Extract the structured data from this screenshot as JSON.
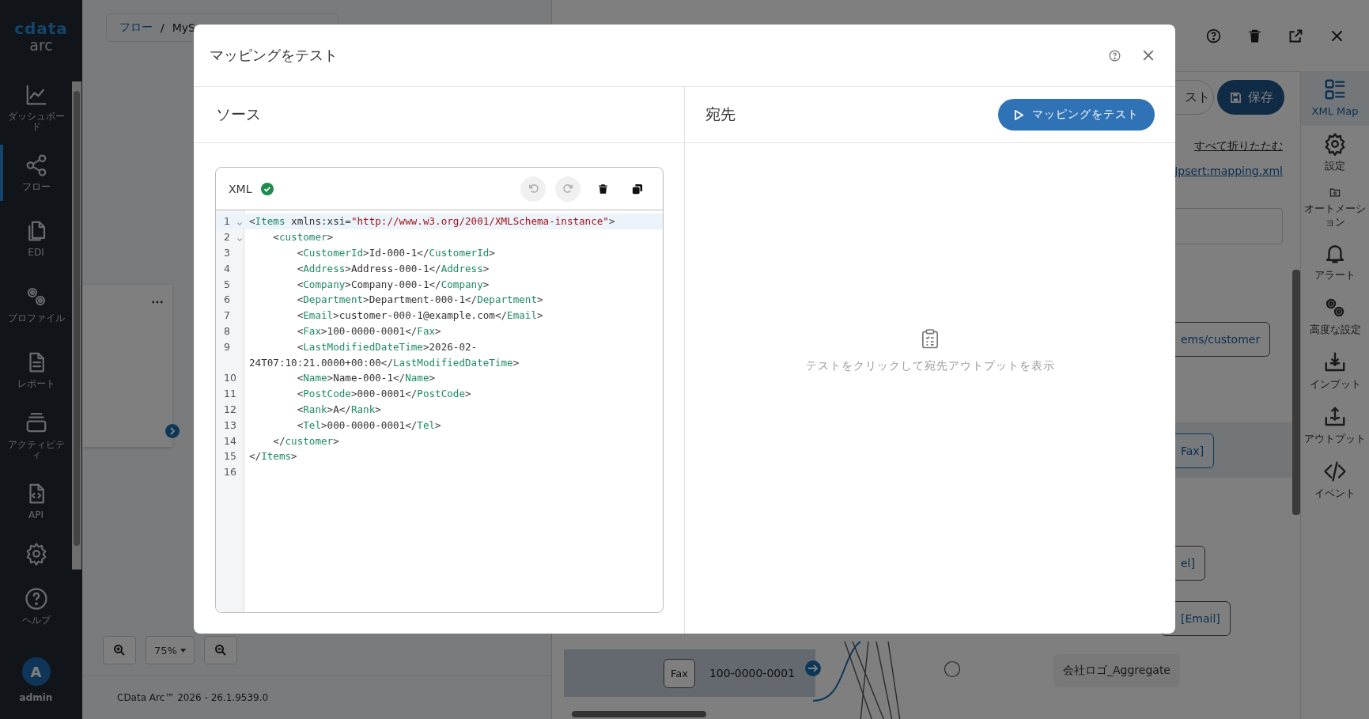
{
  "nav": {
    "logo_top": "cdata",
    "logo_bottom": "arc",
    "items": [
      {
        "label": "ダッシュボード",
        "selected": false
      },
      {
        "label": "フロー",
        "selected": true
      },
      {
        "label": "EDI",
        "selected": false
      },
      {
        "label": "プロファイル",
        "selected": false
      },
      {
        "label": "レポート",
        "selected": false
      },
      {
        "label": "アクティビティ",
        "selected": false
      },
      {
        "label": "API",
        "selected": false
      },
      {
        "selected": false
      },
      {
        "label": "ヘルプ",
        "selected": false
      }
    ],
    "user": {
      "initial": "A",
      "name": "admin"
    }
  },
  "flow_canvas": {
    "breadcrumb": [
      "フロー",
      "/",
      "MyS"
    ],
    "zoom": "75%",
    "footer": "CData Arc™ 2026 - 26.1.9539.0"
  },
  "mapping_panel": {
    "toolbar_buttons": [
      {
        "label": "スト",
        "kind": "outline"
      },
      {
        "label": "保存",
        "kind": "primary"
      }
    ],
    "links": [
      "すべて折りたたむ",
      "Jpsert:mapping.xml"
    ],
    "target_nodes": [
      {
        "label": "ems/customer",
        "highlighted": false
      },
      {
        "label": "Fax]",
        "highlighted": true
      },
      {
        "label": "el]",
        "highlighted": false
      },
      {
        "label": "[Email]",
        "highlighted": false
      }
    ],
    "source_row": {
      "label": "Fax",
      "value": "100-0000-0001"
    },
    "aggregate": "会社ロゴ_Aggregate"
  },
  "right_sidebar": [
    {
      "label": "XML Map",
      "selected": true
    },
    {
      "label": "設定",
      "selected": false
    },
    {
      "label": "オートメーション",
      "selected": false
    },
    {
      "label": "アラート",
      "selected": false
    },
    {
      "label": "高度な設定",
      "selected": false
    },
    {
      "label": "インプット",
      "selected": false
    },
    {
      "label": "アウトプット",
      "selected": false
    },
    {
      "label": "イベント",
      "selected": false
    }
  ],
  "modal": {
    "title": "マッピングをテスト",
    "source": {
      "heading": "ソース",
      "editor": {
        "format": "XML",
        "valid": true,
        "lines": [
          {
            "number": "1",
            "fold": true,
            "active": true,
            "tokens": [
              {
                "kind": "punct",
                "text": "<"
              },
              {
                "kind": "tag",
                "text": "Items"
              },
              {
                "kind": "attr",
                "text": " xmlns:xsi="
              },
              {
                "kind": "string",
                "text": "\"http://www.w3.org/2001/XMLSchema-instance\""
              },
              {
                "kind": "punct",
                "text": ">"
              }
            ]
          },
          {
            "number": "2",
            "fold": true,
            "active": false,
            "tokens": [
              {
                "kind": "punct",
                "text": "    <"
              },
              {
                "kind": "tag",
                "text": "customer"
              },
              {
                "kind": "punct",
                "text": ">"
              }
            ]
          },
          {
            "number": "3",
            "fold": false,
            "active": false,
            "tokens": [
              {
                "kind": "punct",
                "text": "        <"
              },
              {
                "kind": "tag",
                "text": "CustomerId"
              },
              {
                "kind": "punct",
                "text": ">"
              },
              {
                "kind": "text",
                "text": "Id-000-1"
              },
              {
                "kind": "punct",
                "text": "</"
              },
              {
                "kind": "tag",
                "text": "CustomerId"
              },
              {
                "kind": "punct",
                "text": ">"
              }
            ]
          },
          {
            "number": "4",
            "fold": false,
            "active": false,
            "tokens": [
              {
                "kind": "punct",
                "text": "        <"
              },
              {
                "kind": "tag",
                "text": "Address"
              },
              {
                "kind": "punct",
                "text": ">"
              },
              {
                "kind": "text",
                "text": "Address-000-1"
              },
              {
                "kind": "punct",
                "text": "</"
              },
              {
                "kind": "tag",
                "text": "Address"
              },
              {
                "kind": "punct",
                "text": ">"
              }
            ]
          },
          {
            "number": "5",
            "fold": false,
            "active": false,
            "tokens": [
              {
                "kind": "punct",
                "text": "        <"
              },
              {
                "kind": "tag",
                "text": "Company"
              },
              {
                "kind": "punct",
                "text": ">"
              },
              {
                "kind": "text",
                "text": "Company-000-1"
              },
              {
                "kind": "punct",
                "text": "</"
              },
              {
                "kind": "tag",
                "text": "Company"
              },
              {
                "kind": "punct",
                "text": ">"
              }
            ]
          },
          {
            "number": "6",
            "fold": false,
            "active": false,
            "tokens": [
              {
                "kind": "punct",
                "text": "        <"
              },
              {
                "kind": "tag",
                "text": "Department"
              },
              {
                "kind": "punct",
                "text": ">"
              },
              {
                "kind": "text",
                "text": "Department-000-1"
              },
              {
                "kind": "punct",
                "text": "</"
              },
              {
                "kind": "tag",
                "text": "Department"
              },
              {
                "kind": "punct",
                "text": ">"
              }
            ]
          },
          {
            "number": "7",
            "fold": false,
            "active": false,
            "tokens": [
              {
                "kind": "punct",
                "text": "        <"
              },
              {
                "kind": "tag",
                "text": "Email"
              },
              {
                "kind": "punct",
                "text": ">"
              },
              {
                "kind": "text",
                "text": "customer-000-1@example.com"
              },
              {
                "kind": "punct",
                "text": "</"
              },
              {
                "kind": "tag",
                "text": "Email"
              },
              {
                "kind": "punct",
                "text": ">"
              }
            ]
          },
          {
            "number": "8",
            "fold": false,
            "active": false,
            "tokens": [
              {
                "kind": "punct",
                "text": "        <"
              },
              {
                "kind": "tag",
                "text": "Fax"
              },
              {
                "kind": "punct",
                "text": ">"
              },
              {
                "kind": "text",
                "text": "100-0000-0001"
              },
              {
                "kind": "punct",
                "text": "</"
              },
              {
                "kind": "tag",
                "text": "Fax"
              },
              {
                "kind": "punct",
                "text": ">"
              }
            ]
          },
          {
            "number": "9",
            "fold": false,
            "active": false,
            "tokens": [
              {
                "kind": "punct",
                "text": "        <"
              },
              {
                "kind": "tag",
                "text": "LastModifiedDateTime"
              },
              {
                "kind": "punct",
                "text": ">"
              },
              {
                "kind": "text",
                "text": "2026-02-"
              }
            ]
          },
          {
            "fold": false,
            "active": false,
            "tokens": [
              {
                "kind": "text",
                "text": "24T07:10:21.0000+00:00"
              },
              {
                "kind": "punct",
                "text": "</"
              },
              {
                "kind": "tag",
                "text": "LastModifiedDateTime"
              },
              {
                "kind": "punct",
                "text": ">"
              }
            ]
          },
          {
            "number": "10",
            "fold": false,
            "active": false,
            "tokens": [
              {
                "kind": "punct",
                "text": "        <"
              },
              {
                "kind": "tag",
                "text": "Name"
              },
              {
                "kind": "punct",
                "text": ">"
              },
              {
                "kind": "text",
                "text": "Name-000-1"
              },
              {
                "kind": "punct",
                "text": "</"
              },
              {
                "kind": "tag",
                "text": "Name"
              },
              {
                "kind": "punct",
                "text": ">"
              }
            ]
          },
          {
            "number": "11",
            "fold": false,
            "active": false,
            "tokens": [
              {
                "kind": "punct",
                "text": "        <"
              },
              {
                "kind": "tag",
                "text": "PostCode"
              },
              {
                "kind": "punct",
                "text": ">"
              },
              {
                "kind": "text",
                "text": "000-0001"
              },
              {
                "kind": "punct",
                "text": "</"
              },
              {
                "kind": "tag",
                "text": "PostCode"
              },
              {
                "kind": "punct",
                "text": ">"
              }
            ]
          },
          {
            "number": "12",
            "fold": false,
            "active": false,
            "tokens": [
              {
                "kind": "punct",
                "text": "        <"
              },
              {
                "kind": "tag",
                "text": "Rank"
              },
              {
                "kind": "punct",
                "text": ">"
              },
              {
                "kind": "text",
                "text": "A"
              },
              {
                "kind": "punct",
                "text": "</"
              },
              {
                "kind": "tag",
                "text": "Rank"
              },
              {
                "kind": "punct",
                "text": ">"
              }
            ]
          },
          {
            "number": "13",
            "fold": false,
            "active": false,
            "tokens": [
              {
                "kind": "punct",
                "text": "        <"
              },
              {
                "kind": "tag",
                "text": "Tel"
              },
              {
                "kind": "punct",
                "text": ">"
              },
              {
                "kind": "text",
                "text": "000-0000-0001"
              },
              {
                "kind": "punct",
                "text": "</"
              },
              {
                "kind": "tag",
                "text": "Tel"
              },
              {
                "kind": "punct",
                "text": ">"
              }
            ]
          },
          {
            "number": "14",
            "fold": false,
            "active": false,
            "tokens": [
              {
                "kind": "punct",
                "text": "    </"
              },
              {
                "kind": "tag",
                "text": "customer"
              },
              {
                "kind": "punct",
                "text": ">"
              }
            ]
          },
          {
            "number": "15",
            "fold": false,
            "active": false,
            "tokens": [
              {
                "kind": "punct",
                "text": "</"
              },
              {
                "kind": "tag",
                "text": "Items"
              },
              {
                "kind": "punct",
                "text": ">"
              }
            ]
          },
          {
            "number": "16",
            "fold": false,
            "active": false
          }
        ]
      }
    },
    "destination": {
      "heading": "宛先",
      "button": "マッピングをテスト",
      "empty_message": "テストをクリックして宛先アウトプットを表示"
    }
  }
}
